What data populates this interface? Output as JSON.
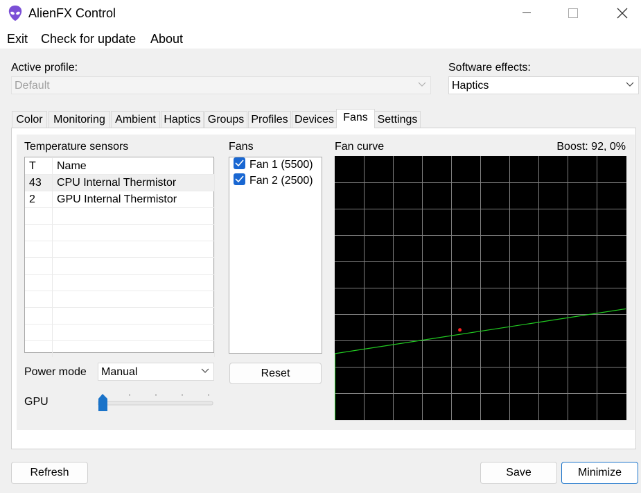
{
  "window": {
    "title": "AlienFX Control"
  },
  "menu": [
    "Exit",
    "Check for update",
    "About"
  ],
  "active_profile": {
    "label": "Active profile:",
    "value": "Default"
  },
  "software_effects": {
    "label": "Software effects:",
    "value": "Haptics"
  },
  "tabs": [
    "Color",
    "Monitoring",
    "Ambient",
    "Haptics",
    "Groups",
    "Profiles",
    "Devices",
    "Fans",
    "Settings"
  ],
  "active_tab": "Fans",
  "sensors": {
    "title": "Temperature sensors",
    "columns": [
      "T",
      "Name"
    ],
    "rows": [
      {
        "t": "43",
        "name": "CPU Internal Thermistor"
      },
      {
        "t": "2",
        "name": "GPU Internal Thermistor"
      }
    ]
  },
  "fans": {
    "title": "Fans",
    "items": [
      {
        "label": "Fan 1 (5500)",
        "checked": true
      },
      {
        "label": "Fan 2 (2500)",
        "checked": true
      }
    ],
    "reset_label": "Reset"
  },
  "fan_curve": {
    "title": "Fan curve",
    "boost": "Boost: 92, 0%"
  },
  "power_mode": {
    "label": "Power mode",
    "value": "Manual"
  },
  "gpu": {
    "label": "GPU",
    "slider_value": 0
  },
  "buttons": {
    "refresh": "Refresh",
    "save": "Save",
    "minimize": "Minimize"
  },
  "chart_data": {
    "type": "line",
    "series": [
      {
        "points": [
          [
            0,
            25
          ],
          [
            100,
            42
          ]
        ]
      }
    ],
    "marker": [
      43,
      34
    ],
    "xlim": [
      0,
      100
    ],
    "ylim": [
      0,
      100
    ],
    "grid": true,
    "colors": {
      "background": "#000000",
      "line": "#22cc22",
      "grid": "#808080",
      "marker": "#ff2020"
    }
  }
}
